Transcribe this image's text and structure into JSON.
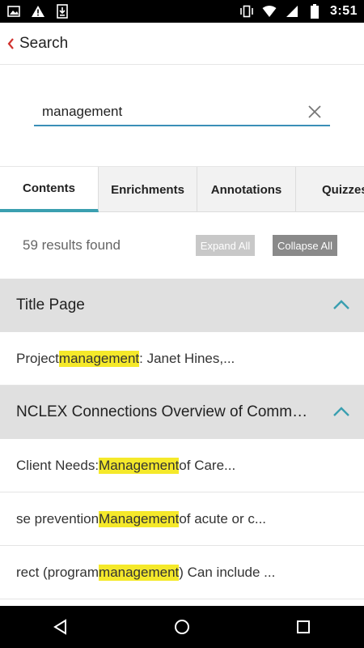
{
  "status": {
    "time": "3:51"
  },
  "header": {
    "title": "Search"
  },
  "search": {
    "value": "management"
  },
  "tabs": [
    {
      "label": "Contents",
      "active": true
    },
    {
      "label": "Enrichments",
      "active": false
    },
    {
      "label": "Annotations",
      "active": false
    },
    {
      "label": "Quizzes",
      "active": false
    }
  ],
  "results": {
    "count_text": "59 results found",
    "expand_label": "Expand All",
    "collapse_label": "Collapse All"
  },
  "sections": [
    {
      "title": "Title Page",
      "rows": [
        {
          "before": "Project ",
          "match": "management",
          "after": ": Janet Hines,..."
        }
      ]
    },
    {
      "title": "NCLEX Connections Overview of Community...",
      "rows": [
        {
          "before": "Client Needs: ",
          "match": "Management",
          "after": " of Care..."
        },
        {
          "before": "se prevention",
          "match": "Management",
          "after": " of acute or c..."
        },
        {
          "before": "rect (program ",
          "match": "management",
          "after": ") Can include ..."
        }
      ]
    }
  ],
  "colors": {
    "accent": "#3a9fb0",
    "highlight": "#f5e92a",
    "back_arrow": "#d0312d"
  }
}
